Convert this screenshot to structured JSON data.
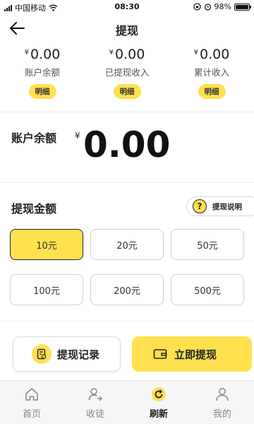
{
  "status_bar": {
    "carrier": "中国移动",
    "time": "08:30",
    "battery": "98%",
    "battery_level": 0.98
  },
  "header": {
    "title": "提现"
  },
  "stats": [
    {
      "currency": "¥",
      "amount": "0.00",
      "label": "账户余额",
      "detail_label": "明细"
    },
    {
      "currency": "¥",
      "amount": "0.00",
      "label": "已提现收入",
      "detail_label": "明细"
    },
    {
      "currency": "¥",
      "amount": "0.00",
      "label": "累计收入",
      "detail_label": "明细"
    }
  ],
  "balance": {
    "label": "账户余额",
    "currency": "¥",
    "value": "0.00"
  },
  "withdraw": {
    "title": "提现金额",
    "explain_label": "提现说明",
    "options": [
      "10元",
      "20元",
      "50元",
      "100元",
      "200元",
      "500元"
    ],
    "selected_index": 0
  },
  "actions": {
    "records_label": "提现记录",
    "withdraw_label": "立即提现"
  },
  "tabbar": {
    "items": [
      {
        "label": "首页",
        "icon": "home-icon"
      },
      {
        "label": "收徒",
        "icon": "add-user-icon"
      },
      {
        "label": "刷新",
        "icon": "refresh-icon"
      },
      {
        "label": "我的",
        "icon": "user-icon"
      }
    ],
    "active_index": 2
  },
  "colors": {
    "accent": "#ffe14f",
    "text": "#222222",
    "muted": "#888888"
  }
}
